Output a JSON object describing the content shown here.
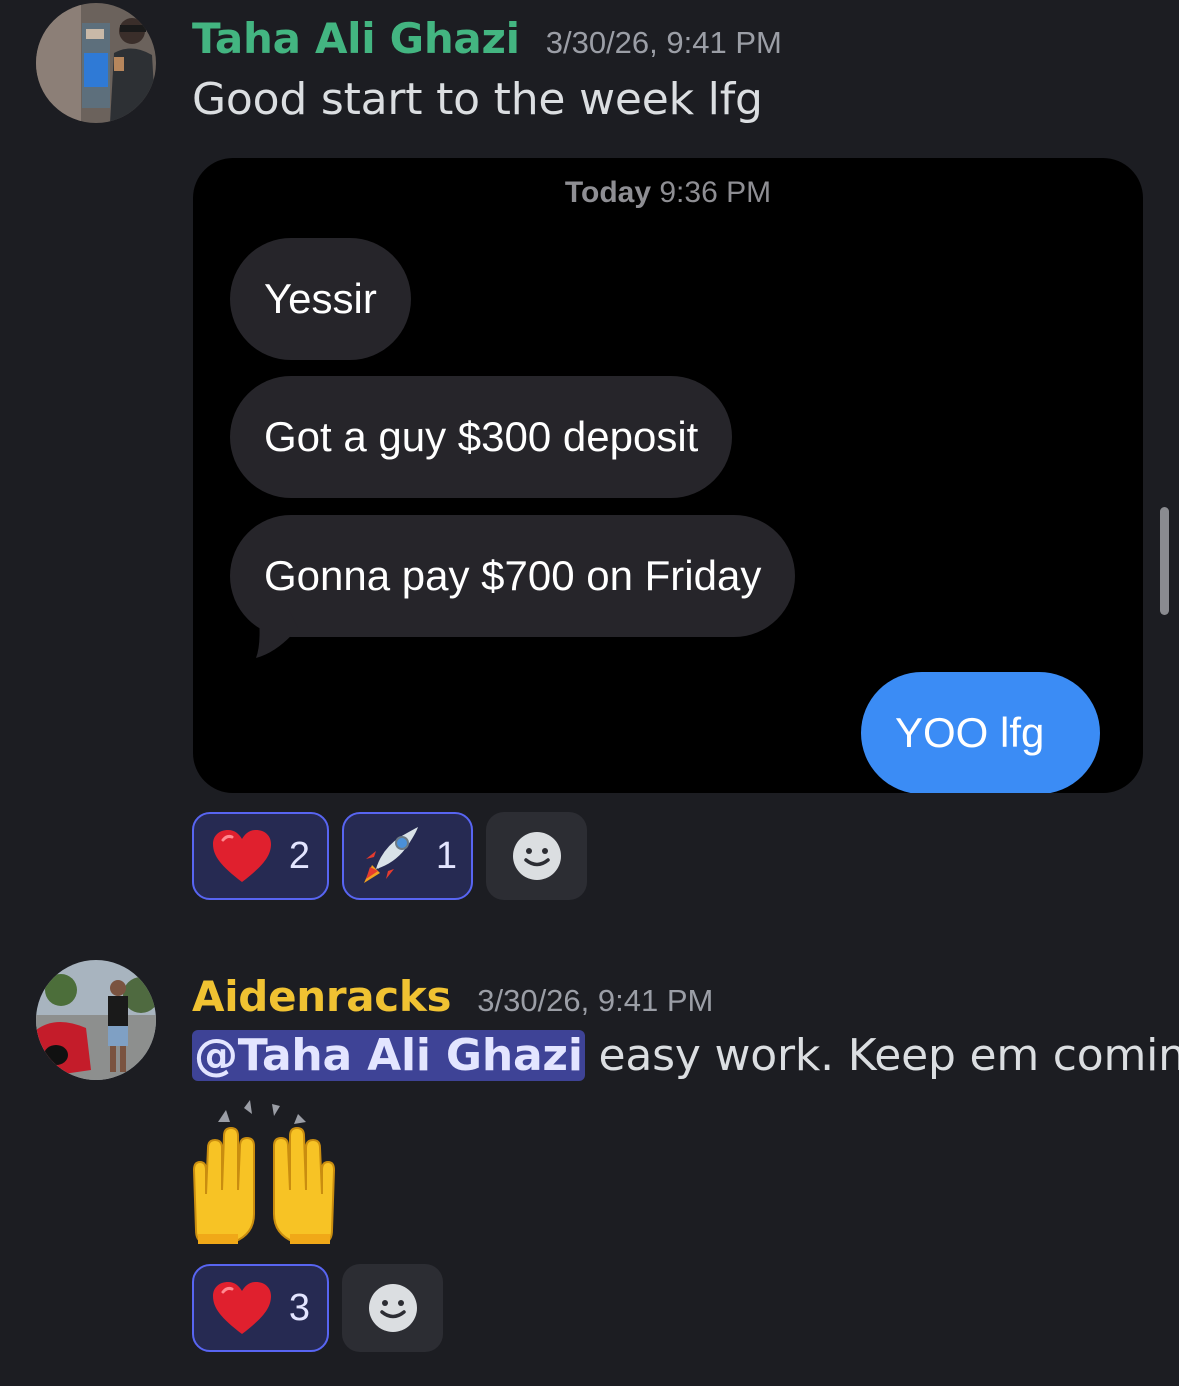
{
  "messages": [
    {
      "author": "Taha Ali Ghazi",
      "author_color": "#43b581",
      "timestamp": "3/30/26, 9:41 PM",
      "text": "Good start to the week lfg",
      "embed": {
        "time_day": "Today",
        "time_clock": "9:36 PM",
        "received": [
          "Yessir",
          "Got a guy $300 deposit",
          "Gonna pay $700 on Friday"
        ],
        "sent": [
          "YOO lfg"
        ]
      },
      "reactions": [
        {
          "emoji": "heart-icon",
          "count": "2"
        },
        {
          "emoji": "rocket-icon",
          "count": "1"
        }
      ]
    },
    {
      "author": "Aidenracks",
      "author_color": "#f0c232",
      "timestamp": "3/30/26, 9:41 PM",
      "mention": "@Taha Ali Ghazi",
      "text": " easy work. Keep em coming",
      "reactions": [
        {
          "emoji": "heart-icon",
          "count": "3"
        }
      ]
    }
  ],
  "colors": {
    "background": "#1c1d22",
    "mention_bg": "#3e4396",
    "reaction_border": "#5865f2",
    "sent_bubble": "#3b8cf5",
    "received_bubble": "#26252a"
  }
}
